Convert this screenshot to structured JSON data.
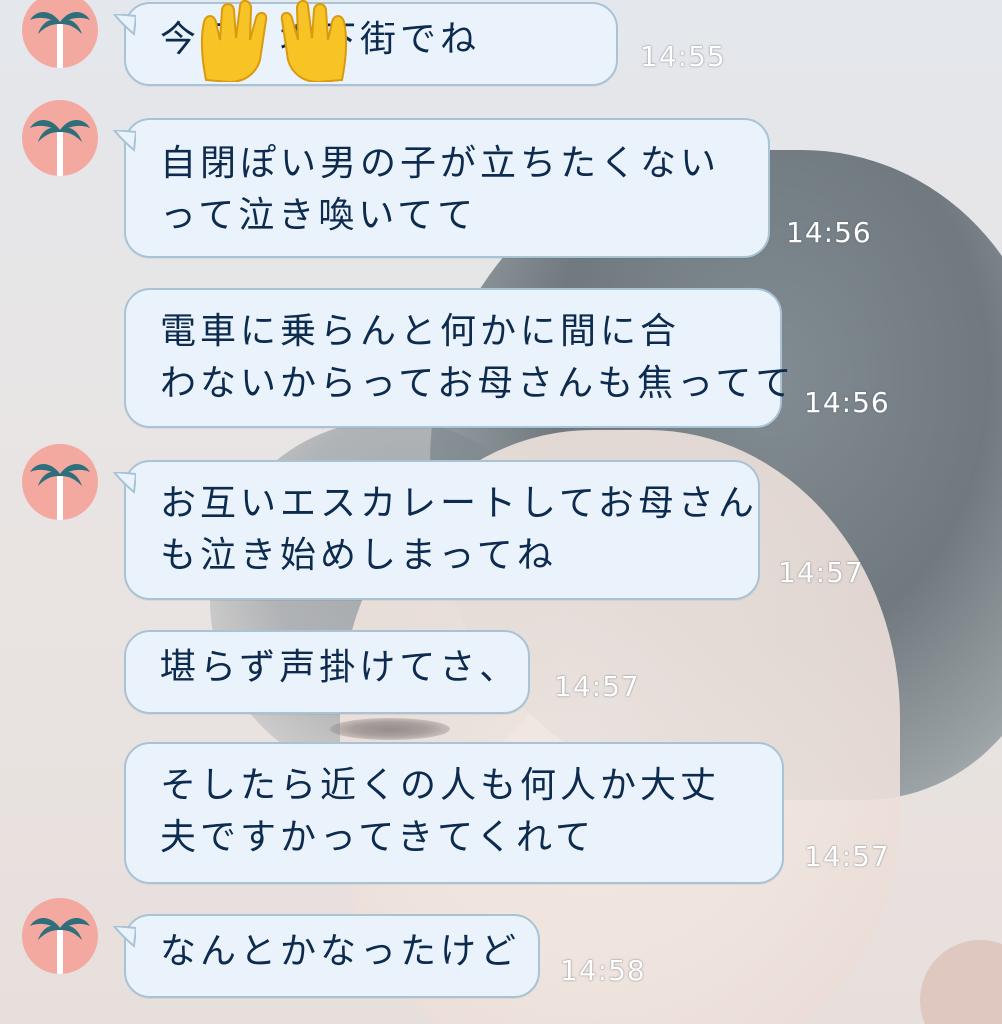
{
  "messages": [
    {
      "lines": [
        "今日、地下街でね"
      ],
      "time": "14:55",
      "avatar": true,
      "sticker": "raising-hands-emoji"
    },
    {
      "lines": [
        "自閉ぽい男の子が立ちたくない",
        "って泣き喚いてて"
      ],
      "time": "14:56",
      "avatar": true
    },
    {
      "lines": [
        "電車に乗らんと何かに間に合",
        "わないからってお母さんも焦ってて"
      ],
      "time": "14:56",
      "avatar": false
    },
    {
      "lines": [
        "お互いエスカレートしてお母さん",
        "も泣き始めしまってね"
      ],
      "time": "14:57",
      "avatar": true
    },
    {
      "lines": [
        "堪らず声掛けてさ、"
      ],
      "time": "14:57",
      "avatar": false
    },
    {
      "lines": [
        "そしたら近くの人も何人か大丈",
        "夫ですかってきてくれて"
      ],
      "time": "14:57",
      "avatar": false
    },
    {
      "lines": [
        "なんとかなったけど"
      ],
      "time": "14:58",
      "avatar": true
    }
  ],
  "avatar_icon": "palm-tree-icon",
  "colors": {
    "bubble_bg": "#eaf3fb",
    "bubble_border": "#a9c3d6",
    "text": "#0d2b4e",
    "avatar_bg": "#f3a9a0",
    "palm": "#2f6f7c",
    "time": "#ffffff"
  }
}
